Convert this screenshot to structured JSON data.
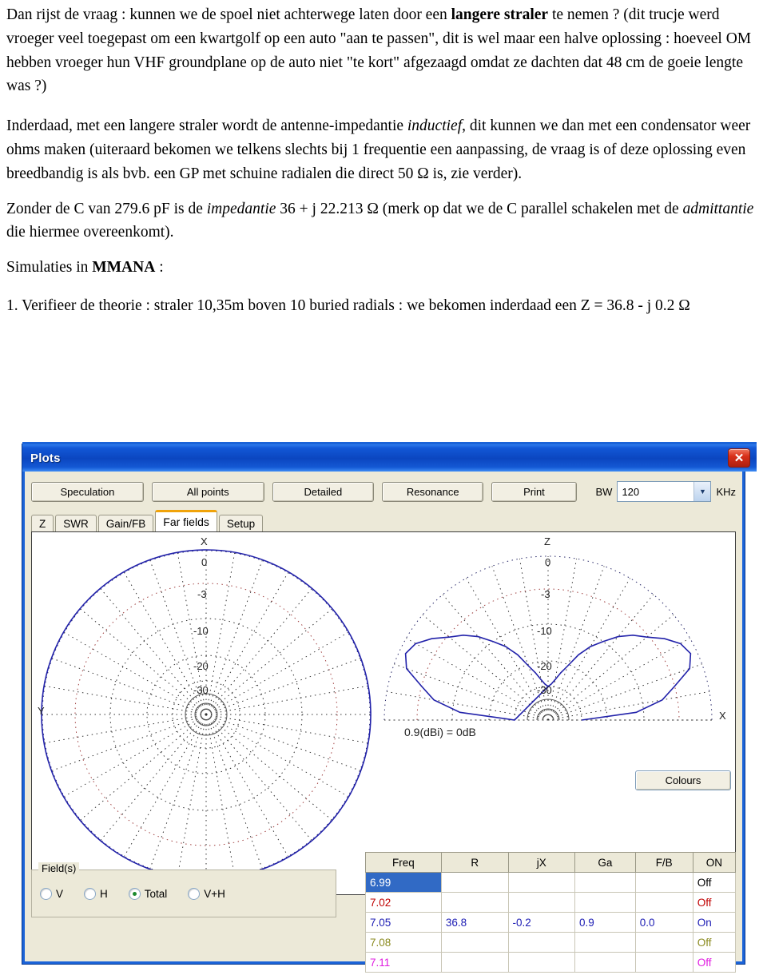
{
  "document": {
    "paragraphs": [
      "Dan rijst de vraag : kunnen we de spoel niet achterwege laten door een ",
      "langere straler",
      " te nemen ?  (dit trucje werd vroeger veel toegepast om een kwartgolf op een auto \"aan te passen\", dit is wel maar een halve oplossing : hoeveel OM hebben vroeger hun VHF groundplane op de auto niet  \"te kort\" afgezaagd omdat ze dachten dat 48 cm de goeie lengte was ?)"
    ],
    "p2_a": "Inderdaad, met een langere straler wordt de antenne-impedantie ",
    "p2_i": "inductief",
    "p2_b": ", dit kunnen we dan met een condensator weer ohms maken (uiteraard bekomen we telkens slechts bij 1 frequentie een aanpassing, de vraag is of deze oplossing even breedbandig is als bvb. een GP met schuine radialen die direct 50 Ω is, zie verder).",
    "p3_a": "Zonder de C van 279.6 pF is de ",
    "p3_i": "impedantie",
    "p3_b": " 36 + j 22.213 Ω  (merk op dat we de C parallel schakelen met de ",
    "p3_i2": "admittantie",
    "p3_c": " die hiermee overeenkomt).",
    "p4_a": "Simulaties in ",
    "p4_b": "MMANA",
    "p4_c": " :",
    "p5": "1. Verifieer de theorie : straler 10,35m boven 10 buried radials : we bekomen inderdaad een Z =  36.8 - j 0.2 Ω"
  },
  "window": {
    "title": "Plots",
    "close_label": "✕",
    "toolbar": {
      "speculation": "Speculation",
      "all_points": "All points",
      "detailed": "Detailed",
      "resonance": "Resonance",
      "print": "Print",
      "bw_label": "BW",
      "bw_value": "120",
      "bw_unit": "KHz",
      "combo_arrow": "▼"
    },
    "tabs": [
      {
        "label": "Z",
        "active": false
      },
      {
        "label": "SWR",
        "active": false
      },
      {
        "label": "Gain/FB",
        "active": false
      },
      {
        "label": "Far fields",
        "active": true
      },
      {
        "label": "Setup",
        "active": false
      }
    ],
    "colours_button": "Colours",
    "fieldset": {
      "legend": "Field(s)",
      "options": [
        {
          "label": "V",
          "selected": false
        },
        {
          "label": "H",
          "selected": false
        },
        {
          "label": "Total",
          "selected": true
        },
        {
          "label": "V+H",
          "selected": false
        }
      ]
    }
  },
  "chart_data": [
    {
      "type": "polar",
      "name": "azimuth-pattern",
      "title": "Azimuth far-field pattern",
      "axis_labels": {
        "top": "X",
        "left": "Y"
      },
      "ring_labels": [
        "0",
        "-3",
        "-10",
        "-20",
        "-30"
      ],
      "ring_values_db": [
        0,
        -3,
        -10,
        -20,
        -30
      ],
      "trace_color": "#2222aa",
      "grid": "polar-dotted",
      "description": "Nearly perfectly omnidirectional circular trace at the 0 dB outer ring",
      "angles_deg": [
        0,
        10,
        20,
        30,
        40,
        50,
        60,
        70,
        80,
        90,
        100,
        110,
        120,
        130,
        140,
        150,
        160,
        170,
        180,
        190,
        200,
        210,
        220,
        230,
        240,
        250,
        260,
        270,
        280,
        290,
        300,
        310,
        320,
        330,
        340,
        350
      ],
      "values_db": [
        0,
        0,
        0,
        0,
        0,
        0,
        0,
        0,
        0,
        0,
        0,
        0,
        0,
        0,
        0,
        0,
        0,
        0,
        0,
        0,
        0,
        0,
        0,
        0,
        0,
        0,
        0,
        0,
        0,
        0,
        0,
        0,
        0,
        0,
        0,
        0
      ]
    },
    {
      "type": "polar",
      "name": "elevation-pattern",
      "title": "Elevation far-field pattern",
      "axis_labels": {
        "top": "Z",
        "right": "X"
      },
      "ring_labels": [
        "0",
        "-3",
        "-10",
        "-20",
        "-30"
      ],
      "ring_values_db": [
        0,
        -3,
        -10,
        -20,
        -30
      ],
      "trace_color": "#2222aa",
      "annotation": "0.9(dBi) = 0dB",
      "gain_dbi": 0.9,
      "grid": "polar-dotted-half",
      "description": "Two symmetric lobes peaking near 25 degrees elevation, deep null at zenith",
      "angles_deg": [
        0,
        5,
        10,
        15,
        20,
        25,
        30,
        35,
        40,
        45,
        50,
        55,
        60,
        65,
        70,
        75,
        80,
        85,
        90
      ],
      "values_db": [
        -30,
        -12,
        -6,
        -3,
        -1.2,
        -0.6,
        -1.0,
        -2.0,
        -3.4,
        -5.2,
        -7.4,
        -10.0,
        -13.0,
        -16.5,
        -20.5,
        -24,
        -27,
        -29,
        -30
      ]
    }
  ],
  "table": {
    "columns": [
      "Freq",
      "R",
      "jX",
      "Ga",
      "F/B",
      "ON"
    ],
    "rows": [
      {
        "freq": "6.99",
        "r": "",
        "jx": "",
        "ga": "",
        "fb": "",
        "on": "Off",
        "color": "#000000",
        "selected": true
      },
      {
        "freq": "7.02",
        "r": "",
        "jx": "",
        "ga": "",
        "fb": "",
        "on": "Off",
        "color": "#c00000",
        "selected": false
      },
      {
        "freq": "7.05",
        "r": "36.8",
        "jx": "-0.2",
        "ga": "0.9",
        "fb": "0.0",
        "on": "On",
        "color": "#1c1cb4",
        "selected": false
      },
      {
        "freq": "7.08",
        "r": "",
        "jx": "",
        "ga": "",
        "fb": "",
        "on": "Off",
        "color": "#8a8a1e",
        "selected": false
      },
      {
        "freq": "7.11",
        "r": "",
        "jx": "",
        "ga": "",
        "fb": "",
        "on": "Off",
        "color": "#e01ce0",
        "selected": false
      }
    ]
  }
}
